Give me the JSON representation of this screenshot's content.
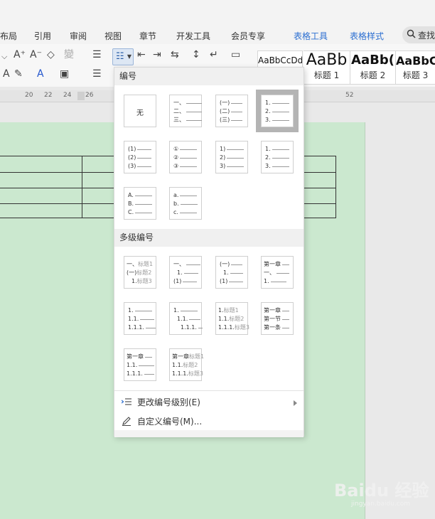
{
  "ribbon": {
    "tabs": [
      {
        "label": "布局"
      },
      {
        "label": "引用"
      },
      {
        "label": "审阅"
      },
      {
        "label": "视图"
      },
      {
        "label": "章节"
      },
      {
        "label": "开发工具"
      },
      {
        "label": "会员专享"
      },
      {
        "label": "表格工具"
      },
      {
        "label": "表格样式"
      }
    ],
    "search_label": "查找"
  },
  "styles": [
    {
      "sample": "AaBbCcDd",
      "name": ""
    },
    {
      "sample": "AaBb",
      "name": "标题 1"
    },
    {
      "sample": "AaBb(",
      "name": "标题 2"
    },
    {
      "sample": "AaBbC",
      "name": "标题 3"
    }
  ],
  "ruler": {
    "numbers": [
      "20",
      "22",
      "24",
      "26",
      "52"
    ]
  },
  "numbering_menu": {
    "section_numbering": "编号",
    "none_label": "无",
    "single_level": [
      {
        "lines": [
          {
            "t": "一、"
          },
          {
            "t": "二、"
          },
          {
            "t": "三、"
          }
        ]
      },
      {
        "lines": [
          {
            "t": "(一)"
          },
          {
            "t": "(二)"
          },
          {
            "t": "(三)"
          }
        ]
      },
      {
        "lines": [
          {
            "t": "1."
          },
          {
            "t": "2."
          },
          {
            "t": "3."
          }
        ]
      },
      {
        "lines": [
          {
            "t": "(1)"
          },
          {
            "t": "(2)"
          },
          {
            "t": "(3)"
          }
        ]
      },
      {
        "lines": [
          {
            "t": "①"
          },
          {
            "t": "②"
          },
          {
            "t": "③"
          }
        ]
      },
      {
        "lines": [
          {
            "t": "1)"
          },
          {
            "t": "2)"
          },
          {
            "t": "3)"
          }
        ]
      },
      {
        "lines": [
          {
            "t": "1."
          },
          {
            "t": "2."
          },
          {
            "t": "3."
          }
        ]
      },
      {
        "lines": [
          {
            "t": "A."
          },
          {
            "t": "B."
          },
          {
            "t": "C."
          }
        ]
      },
      {
        "lines": [
          {
            "t": "a."
          },
          {
            "t": "b."
          },
          {
            "t": "c."
          }
        ]
      }
    ],
    "section_multilevel": "多级编号",
    "multi_level": [
      {
        "lines": [
          {
            "t": "一、",
            "g": "标题1"
          },
          {
            "t": "(一)",
            "g": "标题2"
          },
          {
            "t": "1.",
            "g": "标题3"
          }
        ]
      },
      {
        "lines": [
          {
            "t": "一、"
          },
          {
            "t": "1."
          },
          {
            "t": "(1)"
          }
        ]
      },
      {
        "lines": [
          {
            "t": "(一)"
          },
          {
            "t": "1."
          },
          {
            "t": "(1)"
          }
        ]
      },
      {
        "lines": [
          {
            "t": "第一章"
          },
          {
            "t": "一、"
          },
          {
            "t": "1."
          }
        ]
      },
      {
        "lines": [
          {
            "t": "1."
          },
          {
            "t": "1.1."
          },
          {
            "t": "1.1.1."
          }
        ]
      },
      {
        "lines": [
          {
            "t": "1."
          },
          {
            "t": "1.1."
          },
          {
            "t": "1.1.1."
          }
        ]
      },
      {
        "lines": [
          {
            "t": "1.",
            "g": "标题1"
          },
          {
            "t": "1.1.",
            "g": "标题2"
          },
          {
            "t": "1.1.1.",
            "g": "标题3"
          }
        ]
      },
      {
        "lines": [
          {
            "t": "第一章"
          },
          {
            "t": "第一节"
          },
          {
            "t": "第一条"
          }
        ]
      },
      {
        "lines": [
          {
            "t": "第一章"
          },
          {
            "t": "1.1."
          },
          {
            "t": "1.1.1."
          }
        ]
      },
      {
        "lines": [
          {
            "t": "第一章",
            "g": "标题1"
          },
          {
            "t": "1.1.",
            "g": "标题2"
          },
          {
            "t": "1.1.1.",
            "g": "标题3"
          }
        ]
      }
    ],
    "change_level_label": "更改编号级别(E)",
    "custom_label": "自定义编号(M)..."
  },
  "watermark": {
    "logo_text": "Baidu 经验",
    "url": "jingyan.baidu.com"
  }
}
